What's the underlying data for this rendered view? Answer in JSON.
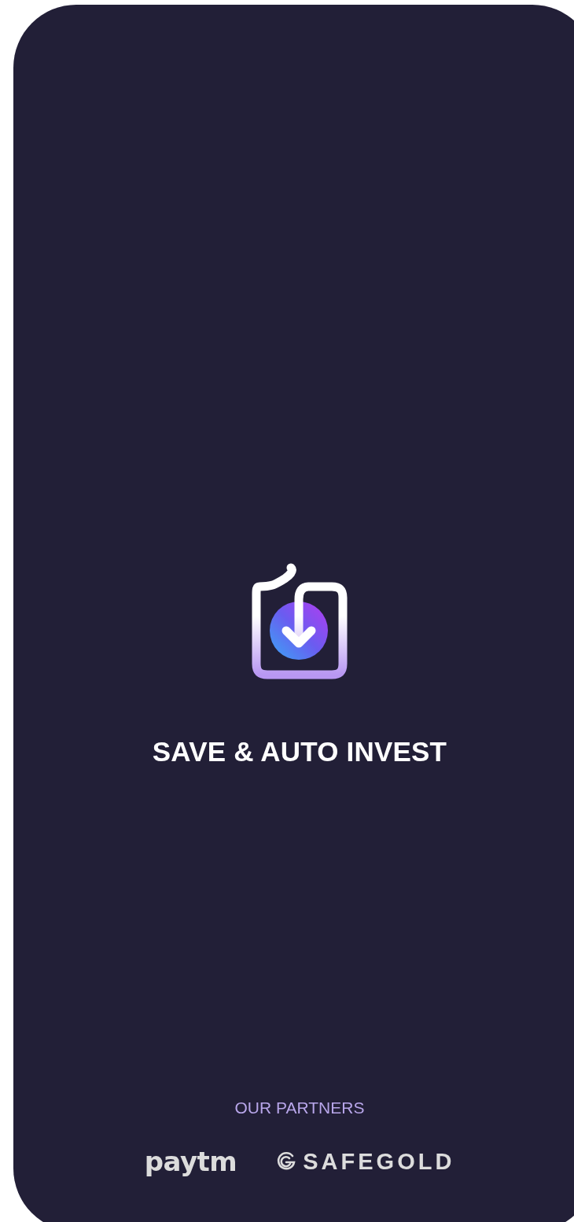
{
  "splash": {
    "title": "SAVE & AUTO INVEST"
  },
  "partners": {
    "heading": "OUR PARTNERS",
    "logos": [
      {
        "kind": "paytm",
        "name": "paytm"
      },
      {
        "kind": "safegold",
        "name": "SAFEGOLD"
      }
    ]
  }
}
